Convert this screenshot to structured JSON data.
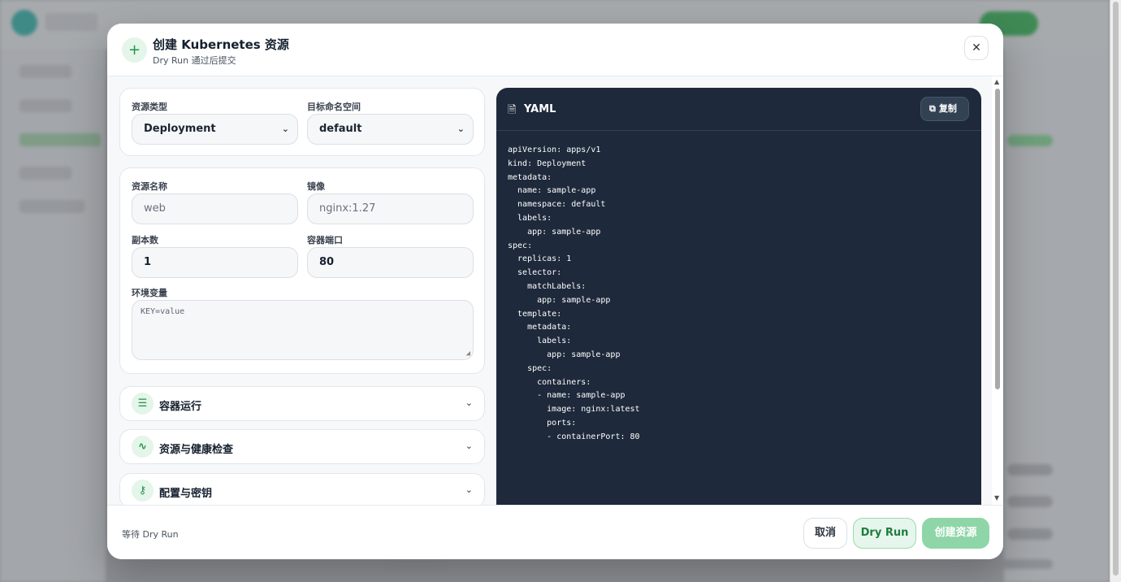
{
  "modal": {
    "title": "创建 Kubernetes 资源",
    "subtitle": "Dry Run 通过后提交",
    "close_icon": "close-icon"
  },
  "form": {
    "resource_type": {
      "label": "资源类型",
      "value": "Deployment"
    },
    "namespace": {
      "label": "目标命名空间",
      "value": "default"
    },
    "name": {
      "label": "资源名称",
      "placeholder": "web"
    },
    "image": {
      "label": "镜像",
      "placeholder": "nginx:1.27"
    },
    "replicas": {
      "label": "副本数",
      "value": "1"
    },
    "port": {
      "label": "容器端口",
      "value": "80"
    },
    "env": {
      "label": "环境变量",
      "placeholder": "KEY=value"
    }
  },
  "sections": [
    {
      "title": "容器运行",
      "icon": "sliders-icon"
    },
    {
      "title": "资源与健康检查",
      "icon": "activity-icon"
    },
    {
      "title": "配置与密钥",
      "icon": "key-icon"
    }
  ],
  "yaml": {
    "title": "YAML",
    "copy_label": "复制",
    "code": "apiVersion: apps/v1\nkind: Deployment\nmetadata:\n  name: sample-app\n  namespace: default\n  labels:\n    app: sample-app\nspec:\n  replicas: 1\n  selector:\n    matchLabels:\n      app: sample-app\n  template:\n    metadata:\n      labels:\n        app: sample-app\n    spec:\n      containers:\n      - name: sample-app\n        image: nginx:latest\n        ports:\n        - containerPort: 80"
  },
  "footer": {
    "status": "等待 Dry Run",
    "cancel_label": "取消",
    "dry_run_label": "Dry Run",
    "create_label": "创建资源"
  },
  "colors": {
    "accent_green": "#25924a",
    "yaml_bg": "#1e293b",
    "create_disabled": "#8ed6a8"
  }
}
